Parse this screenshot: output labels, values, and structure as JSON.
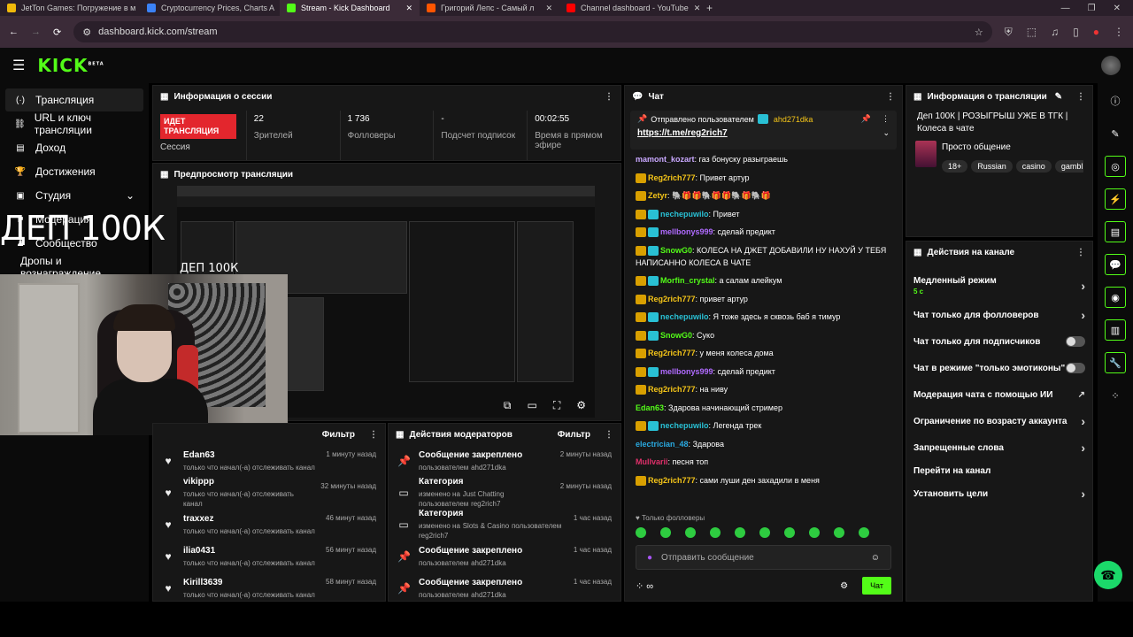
{
  "browser": {
    "tabs": [
      {
        "title": "JetTon Games: Погружение в м",
        "color": "#f0b90b"
      },
      {
        "title": "Cryptocurrency Prices, Charts A",
        "color": "#3b82f6"
      },
      {
        "title": "Stream - Kick Dashboard",
        "color": "#53fc18"
      },
      {
        "title": "Григорий Лепс - Самый л",
        "color": "#ff5500"
      },
      {
        "title": "Channel dashboard - YouTube",
        "color": "#ff0000"
      }
    ],
    "url": "dashboard.kick.com/stream"
  },
  "kick": {
    "logo": "KICK",
    "beta": "BETA"
  },
  "sidebar": {
    "items": [
      {
        "label": "Трансляция",
        "icon": "(·)"
      },
      {
        "label": "URL и ключ трансляции",
        "icon": "⛓"
      },
      {
        "label": "Доход",
        "icon": "▤"
      },
      {
        "label": "Достижения",
        "icon": "🏆"
      },
      {
        "label": "Студия",
        "icon": "▣"
      },
      {
        "label": "Модерация",
        "icon": "⚑"
      },
      {
        "label": "Сообщество",
        "icon": "♟"
      },
      {
        "label": "Дропы и вознаграждение",
        "icon": ""
      }
    ]
  },
  "overlay": {
    "big": "ДЕП 100К",
    "small": "ДЕП 100К"
  },
  "session": {
    "title": "Информация о сессии",
    "live_badge": "ИДЕТ ТРАНСЛЯЦИЯ",
    "live_label": "Сессия",
    "stats": [
      {
        "value": "22",
        "label": "Зрителей"
      },
      {
        "value": "1 736",
        "label": "Фолловеры"
      },
      {
        "value": "-",
        "label": "Подсчет подписок"
      },
      {
        "value": "00:02:55",
        "label": "Время в прямом эфире"
      }
    ]
  },
  "preview": {
    "title": "Предпросмотр трансляции"
  },
  "activity": {
    "title": "Лента активности",
    "filter": "Фильтр",
    "items": [
      {
        "name": "Edan63",
        "desc": "только что начал(-а) отслеживать канал",
        "time": "1 минуту назад"
      },
      {
        "name": "vikippp",
        "desc": "только что начал(-а) отслеживать канал",
        "time": "32 минуты назад"
      },
      {
        "name": "traxxez",
        "desc": "только что начал(-а) отслеживать канал",
        "time": "46 минут назад"
      },
      {
        "name": "ilia0431",
        "desc": "только что начал(-а) отслеживать канал",
        "time": "56 минут назад"
      },
      {
        "name": "Kirill3639",
        "desc": "только что начал(-а) отслеживать канал",
        "time": "58 минут назад"
      }
    ]
  },
  "modactions": {
    "title": "Действия модераторов",
    "filter": "Фильтр",
    "items": [
      {
        "title": "Сообщение закреплено",
        "pre": "пользователем",
        "mid": "",
        "post": "",
        "user": "ahd271dka",
        "time": "2 минуты назад",
        "icon": "📌"
      },
      {
        "title": "Категория",
        "pre": "изменено на",
        "mid": "Just Chatting",
        "post": "пользователем",
        "user": "reg2rich7",
        "time": "2 минуты назад",
        "icon": "▭"
      },
      {
        "title": "Категория",
        "pre": "изменено на",
        "mid": "Slots & Casino",
        "post": "пользователем",
        "user": "reg2rich7",
        "time": "1 час назад",
        "icon": "▭"
      },
      {
        "title": "Сообщение закреплено",
        "pre": "пользователем",
        "mid": "",
        "post": "",
        "user": "ahd271dka",
        "time": "1 час назад",
        "icon": "📌"
      },
      {
        "title": "Сообщение закреплено",
        "pre": "пользователем",
        "mid": "",
        "post": "",
        "user": "ahd271dka",
        "time": "1 час назад",
        "icon": "📌"
      }
    ]
  },
  "chat": {
    "title": "Чат",
    "pinned_by": "Отправлено пользователем",
    "pinned_user": "ahd271dka",
    "pinned_link": "https://t.me/reg2rich7",
    "messages": [
      {
        "user": "mamont_kozart",
        "color": "#c9a8ff",
        "text": "газ бонуску разыграешь",
        "badges": 0
      },
      {
        "user": "Reg2rich777",
        "color": "#f5c518",
        "text": "Привет артур",
        "badges": 1
      },
      {
        "user": "Zetyr",
        "color": "#f5c518",
        "text": "🐘🎁🎁🐘🎁🎁🐘🎁🐘🎁",
        "badges": 1
      },
      {
        "user": "nechepuwilo",
        "color": "#29c0d4",
        "text": "Привет",
        "badges": 2
      },
      {
        "user": "mellbonys999",
        "color": "#b06bff",
        "text": "сделай предикт",
        "badges": 2
      },
      {
        "user": "SnowG0",
        "color": "#53fc18",
        "text": "КОЛЕСА НА ДЖЕТ ДОБАВИЛИ НУ НАХУЙ У ТЕБЯ НАПИСАННО КОЛЕСА В ЧАТЕ",
        "badges": 2
      },
      {
        "user": "Morfin_crystal",
        "color": "#53fc18",
        "text": "а салам алейкум",
        "badges": 2
      },
      {
        "user": "Reg2rich777",
        "color": "#f5c518",
        "text": "привет артур",
        "badges": 1
      },
      {
        "user": "nechepuwilo",
        "color": "#29c0d4",
        "text": "Я тоже здесь я сквозь баб я тимур",
        "badges": 2
      },
      {
        "user": "SnowG0",
        "color": "#53fc18",
        "text": "Суко",
        "badges": 2
      },
      {
        "user": "Reg2rich777",
        "color": "#f5c518",
        "text": "у меня колеса дома",
        "badges": 1
      },
      {
        "user": "mellbonys999",
        "color": "#b06bff",
        "text": "сделай предикт",
        "badges": 2
      },
      {
        "user": "Reg2rich777",
        "color": "#f5c518",
        "text": "на ниву",
        "badges": 1
      },
      {
        "user": "Edan63",
        "color": "#53fc18",
        "text": "Здарова начинающий стример",
        "badges": 0
      },
      {
        "user": "nechepuwilo",
        "color": "#29c0d4",
        "text": "Легенда трек",
        "badges": 2
      },
      {
        "user": "electrician_48",
        "color": "#29a9e0",
        "text": "Здарова",
        "badges": 0
      },
      {
        "user": "Mullvarii",
        "color": "#e0306a",
        "text": "песня топ",
        "badges": 0
      },
      {
        "user": "Reg2rich777",
        "color": "#f5c518",
        "text": "сами луши ден захадили в меня",
        "badges": 1
      }
    ],
    "followers_label": "Только фолловеры",
    "input_placeholder": "Отправить сообщение",
    "send_label": "Чат"
  },
  "streaminfo": {
    "title": "Информация о трансляции",
    "stream_title": "Деп 100К | РОЗЫГРЫШ УЖЕ В ТГК | Колеса в чате",
    "category": "Просто общение",
    "tags": [
      "18+",
      "Russian",
      "casino",
      "gambl"
    ]
  },
  "channel_actions": {
    "title": "Действия на канале",
    "slow_mode": "Медленный режим",
    "slow_value": "5 с",
    "items": [
      {
        "label": "Чат только для фолловеров",
        "control": "chevron"
      },
      {
        "label": "Чат только для подписчиков",
        "control": "toggle"
      },
      {
        "label": "Чат в режиме \"только эмотиконы\"",
        "control": "toggle"
      },
      {
        "label": "Модерация чата с помощью ИИ",
        "control": "external"
      },
      {
        "label": "Ограничение по возрасту аккаунта",
        "control": "chevron"
      },
      {
        "label": "Запрещенные слова",
        "control": "chevron"
      },
      {
        "label": "Перейти на канал",
        "control": "none"
      },
      {
        "label": "Установить цели",
        "control": "chevron"
      }
    ]
  }
}
